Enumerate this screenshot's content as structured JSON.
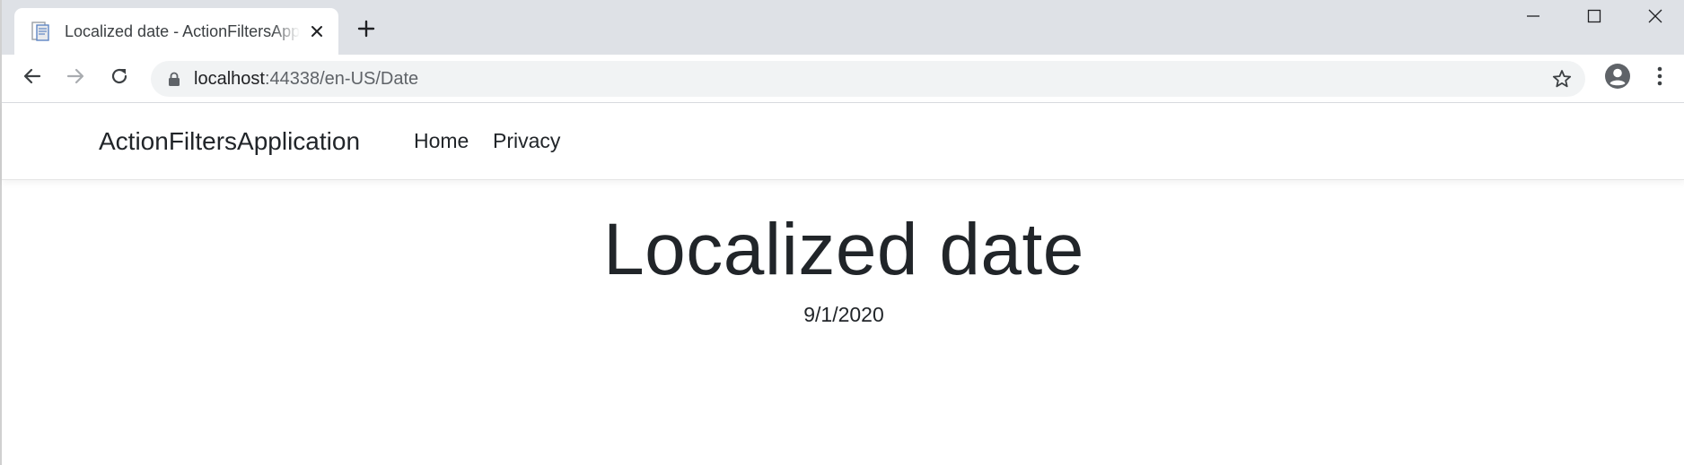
{
  "browser": {
    "tab": {
      "title": "Localized date - ActionFiltersApplication",
      "favicon": "page-icon",
      "close": "close-icon"
    },
    "new_tab": "plus-icon",
    "window_controls": [
      "minimize-icon",
      "maximize-icon",
      "close-icon"
    ],
    "toolbar": {
      "back": "arrow-left-icon",
      "forward": "arrow-right-icon",
      "reload": "reload-icon",
      "lock": "lock-icon",
      "url_host": "localhost",
      "url_rest": ":44338/en-US/Date",
      "star": "star-icon",
      "profile": "account-circle-icon",
      "menu": "more-vert-icon"
    }
  },
  "site": {
    "brand": "ActionFiltersApplication",
    "nav": [
      {
        "label": "Home"
      },
      {
        "label": "Privacy"
      }
    ]
  },
  "main": {
    "title": "Localized date",
    "date": "9/1/2020"
  },
  "colors": {
    "tabstrip": "#dee1e6",
    "omnibox": "#f1f3f4",
    "text": "#212529"
  }
}
